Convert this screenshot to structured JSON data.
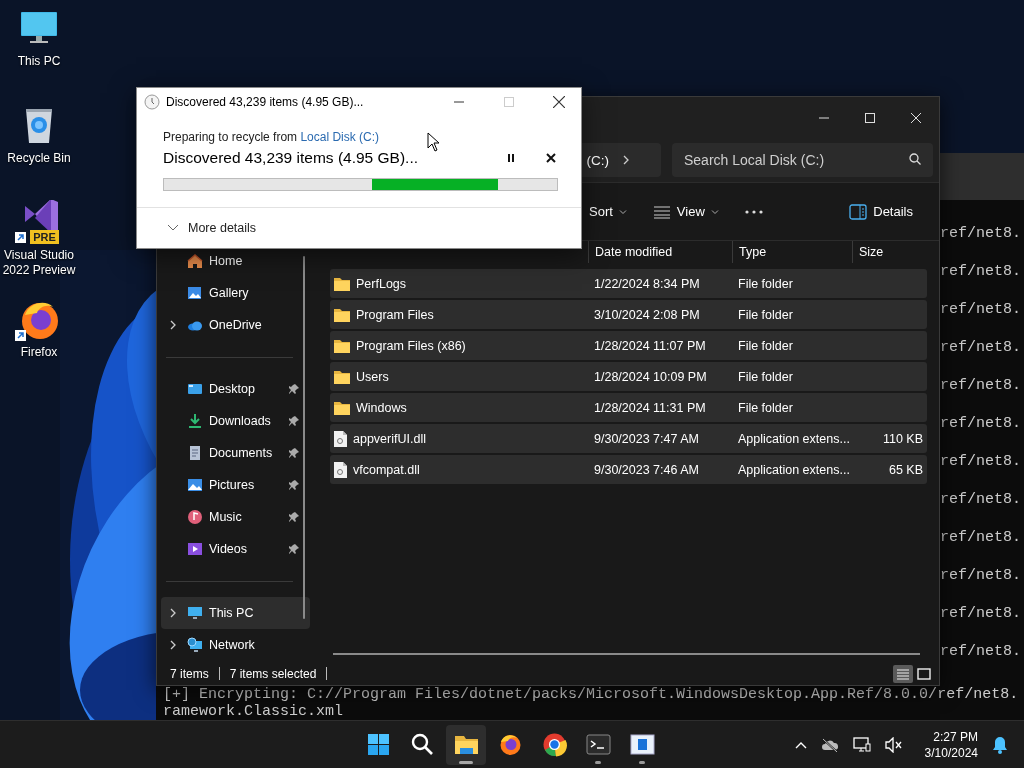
{
  "desktop_icons": [
    {
      "kind": "pc",
      "label": "This PC",
      "shortcut": false
    },
    {
      "kind": "recycle",
      "label": "Recycle Bin",
      "shortcut": false
    },
    {
      "kind": "vs",
      "label": "Visual Studio 2022 Preview",
      "badge": "PRE",
      "shortcut": true
    },
    {
      "kind": "firefox",
      "label": "Firefox",
      "shortcut": true
    }
  ],
  "terminal": {
    "right_lines": [
      "ref/net8.",
      "ref/net8.",
      "ref/net8.",
      "ref/net8.",
      "ref/net8.",
      "ref/net8.",
      "ref/net8.",
      "ref/net8.",
      "ref/net8.",
      "ref/net8.",
      "ref/net8.",
      "ref/net8."
    ],
    "bottom_lines": [
      "[+] Encrypting: C://Program Files/dotnet/packs/Microsoft.WindowsDesktop.App.Ref/8.0.0/ref/net8.",
      "ramework.Classic.xml"
    ]
  },
  "explorer": {
    "address": {
      "location": "(C:)"
    },
    "search": {
      "placeholder": "Search Local Disk (C:)"
    },
    "toolbar": [
      {
        "kind": "sort",
        "label": "Sort"
      },
      {
        "kind": "view",
        "label": "View"
      },
      {
        "kind": "more"
      },
      {
        "kind": "details",
        "label": "Details"
      }
    ],
    "sidebar": [
      {
        "kind": "home",
        "label": "Home",
        "expandable": false,
        "pinned": false,
        "selected": false
      },
      {
        "kind": "gallery",
        "label": "Gallery",
        "expandable": false,
        "pinned": false,
        "selected": false
      },
      {
        "kind": "cloud",
        "label": "OneDrive",
        "expandable": true,
        "pinned": false,
        "selected": false
      },
      {
        "kind": "divider"
      },
      {
        "kind": "desktop",
        "label": "Desktop",
        "expandable": false,
        "pinned": true,
        "selected": false
      },
      {
        "kind": "download",
        "label": "Downloads",
        "expandable": false,
        "pinned": true,
        "selected": false
      },
      {
        "kind": "document",
        "label": "Documents",
        "expandable": false,
        "pinned": true,
        "selected": false
      },
      {
        "kind": "pictures",
        "label": "Pictures",
        "expandable": false,
        "pinned": true,
        "selected": false
      },
      {
        "kind": "music",
        "label": "Music",
        "expandable": false,
        "pinned": true,
        "selected": false
      },
      {
        "kind": "videos",
        "label": "Videos",
        "expandable": false,
        "pinned": true,
        "selected": false
      },
      {
        "kind": "divider"
      },
      {
        "kind": "pc",
        "label": "This PC",
        "expandable": true,
        "pinned": false,
        "selected": true
      },
      {
        "kind": "network",
        "label": "Network",
        "expandable": true,
        "pinned": false,
        "selected": false
      }
    ],
    "columns": [
      "Date modified",
      "Type",
      "Size"
    ],
    "rows": [
      {
        "kind": "folder",
        "name": "PerfLogs",
        "date": "1/22/2024 8:34 PM",
        "type": "File folder",
        "selected": true
      },
      {
        "kind": "folder",
        "name": "Program Files",
        "date": "3/10/2024 2:08 PM",
        "type": "File folder",
        "selected": true
      },
      {
        "kind": "folder",
        "name": "Program Files (x86)",
        "date": "1/28/2024 11:07 PM",
        "type": "File folder",
        "selected": true
      },
      {
        "kind": "folder",
        "name": "Users",
        "date": "1/28/2024 10:09 PM",
        "type": "File folder",
        "selected": true
      },
      {
        "kind": "folder",
        "name": "Windows",
        "date": "1/28/2024 11:31 PM",
        "type": "File folder",
        "selected": true
      },
      {
        "kind": "file",
        "name": "appverifUI.dll",
        "date": "9/30/2023 7:47 AM",
        "type": "Application extens...",
        "size": "110 KB",
        "selected": true
      },
      {
        "kind": "file",
        "name": "vfcompat.dll",
        "date": "9/30/2023 7:46 AM",
        "type": "Application extens...",
        "size": "65 KB",
        "selected": true
      }
    ],
    "status_bar": {
      "count": "7 items",
      "selection": "7 items selected"
    },
    "view_modes": [
      {
        "kind": "details",
        "selected": true
      },
      {
        "kind": "tiles",
        "selected": false
      }
    ]
  },
  "dialog": {
    "title": "Discovered 43,239 items (4.95 GB)...",
    "maximize_disabled": true,
    "caption": "Preparing to recycle from",
    "link": "Local Disk (C:)",
    "status": "Discovered 43,239 items (4.95 GB)...",
    "progress": {
      "indeterminate": true
    },
    "details": {
      "label": "More details",
      "expanded": false
    }
  },
  "taskbar": {
    "apps": [
      {
        "kind": "start",
        "active": false,
        "running": false
      },
      {
        "kind": "search",
        "active": false,
        "running": false
      },
      {
        "kind": "explorer",
        "active": true,
        "running": true
      },
      {
        "kind": "firefox",
        "active": false,
        "running": false
      },
      {
        "kind": "chrome",
        "active": false,
        "running": false
      },
      {
        "kind": "terminal",
        "active": false,
        "running": true
      },
      {
        "kind": "app",
        "active": false,
        "running": true
      }
    ],
    "clock": {
      "time": "2:27 PM",
      "date": "3/10/2024"
    }
  }
}
